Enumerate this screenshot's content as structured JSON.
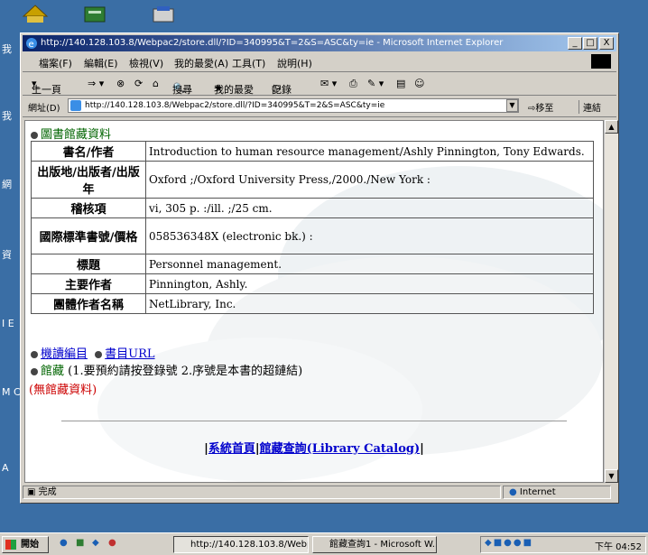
{
  "desktop": {
    "side_labels": [
      "我",
      "我",
      "網",
      "資",
      "I E",
      "M C",
      "A"
    ]
  },
  "window": {
    "title": "http://140.128.103.8/Webpac2/store.dll/?ID=340995&T=2&S=ASC&ty=ie - Microsoft Internet Explorer",
    "minimize": "_",
    "maximize": "□",
    "close": "X"
  },
  "menu": [
    "檔案(F)",
    "編輯(E)",
    "檢視(V)",
    "我的最愛(A)",
    "工具(T)",
    "說明(H)"
  ],
  "toolbar": {
    "back": "上一頁",
    "search": "搜尋",
    "favorites": "我的最愛",
    "history": "記錄"
  },
  "address": {
    "label": "網址(D)",
    "url": "http://140.128.103.8/Webpac2/store.dll/?ID=340995&T=2&S=ASC&ty=ie",
    "go": "移至",
    "links": "連結"
  },
  "page": {
    "section_title": "圖書館藏資料",
    "rows": [
      {
        "label": "書名/作者",
        "value": "Introduction to human resource management/Ashly Pinnington, Tony Edwards."
      },
      {
        "label": "出版地/出版者/出版年",
        "value": "Oxford ;/Oxford University Press,/2000./New York :"
      },
      {
        "label": "稽核項",
        "value": "vi, 305 p. :/ill. ;/25 cm."
      },
      {
        "label": "國際標準書號/價格",
        "value": "058536348X (electronic bk.) :"
      },
      {
        "label": "標題",
        "value": "Personnel management."
      },
      {
        "label": "主要作者",
        "value": "Pinnington, Ashly."
      },
      {
        "label": "團體作者名稱",
        "value": "NetLibrary, Inc."
      }
    ],
    "link_marc": "機讀編目",
    "link_url": "書目URL",
    "holdings_label": "館藏",
    "holdings_note": "(1.要預約請按登錄號 2.序號是本書的超鏈結)",
    "no_holdings": "(無館藏資料)",
    "footer_home": "系統首頁",
    "footer_catalog": "館藏查詢(Library Catalog)"
  },
  "status": {
    "text": "完成",
    "zone": "Internet"
  },
  "taskbar": {
    "start": "開始",
    "tasks": [
      "http://140.128.103.8/Webp...",
      "館藏查詢1 - Microsoft W..."
    ],
    "clock": "下午 04:52"
  }
}
